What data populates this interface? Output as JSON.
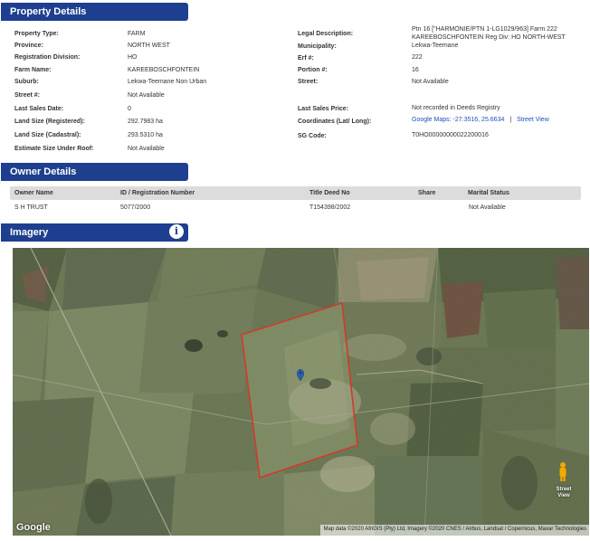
{
  "property": {
    "header": "Property Details",
    "left": [
      {
        "label": "Property Type:",
        "value": "FARM"
      },
      {
        "label": "Province:",
        "value": "NORTH WEST"
      },
      {
        "label": "Registration Division:",
        "value": "HO"
      },
      {
        "label": "Farm Name:",
        "value": "KAREEBOSCHFONTEIN"
      },
      {
        "label": "Suburb:",
        "value": "Lekwa-Teemane Non Urban"
      },
      {
        "label": "Street #:",
        "value": "Not Available"
      },
      {
        "label": "Last Sales Date:",
        "value": "0"
      },
      {
        "label": "Land Size (Registered):",
        "value": "292.7983 ha"
      },
      {
        "label": "Land Size (Cadastral):",
        "value": "293.5310 ha"
      },
      {
        "label": "Estimate Size Under Roof:",
        "value": "Not Available"
      }
    ],
    "right": {
      "legal_label": "Legal Description:",
      "legal_line1": "Ptn 16 [\"HARMONIE/PTN 1-LG1029/963] Farm 222",
      "legal_line2": "KAREEBOSCHFONTEIN Reg Div: HO NORTH-WEST",
      "municipality_label": "Municipality:",
      "municipality_value": "Lekwa-Teemane",
      "erf_label": "Erf #:",
      "erf_value": "222",
      "portion_label": "Portion #:",
      "portion_value": "16",
      "street_label": "Street:",
      "street_value": "Not Available",
      "sales_price_label": "Last Sales Price:",
      "sales_price_value": "Not recorded in Deeds Registry",
      "coords_label": "Coordinates (Lat/ Long):",
      "coords_value": "Google Maps: -27.3516, 25.6634",
      "coords_sep": "|",
      "street_view_link": "Street View",
      "sg_label": "SG Code:",
      "sg_value": "T0HO00000000022200016"
    }
  },
  "owner": {
    "header": "Owner Details",
    "columns": [
      "Owner Name",
      "ID / Registration Number",
      "Title Deed No",
      "Share",
      "Marital Status"
    ],
    "row": [
      "S H TRUST",
      "5077/2000",
      "T154398/2002",
      "",
      "Not Available"
    ]
  },
  "imagery": {
    "header": "Imagery",
    "info_glyph": "i",
    "google_logo": "Google",
    "attribution": "Map data ©2020 AfriGIS (Pty) Ltd, Imagery ©2020 CNES / Airbus, Landsat / Copernicus, Maxar Technologies",
    "street_view_label_1": "Street",
    "street_view_label_2": "View",
    "colors": {
      "boundary": "#d23a2a",
      "pin": "#2a5fa8",
      "pegman": "#f5a800"
    }
  },
  "colors": {
    "section_bar": "#1e3f8f",
    "link": "#1f4fbf",
    "owner_header_bg": "#dcdcdc"
  }
}
